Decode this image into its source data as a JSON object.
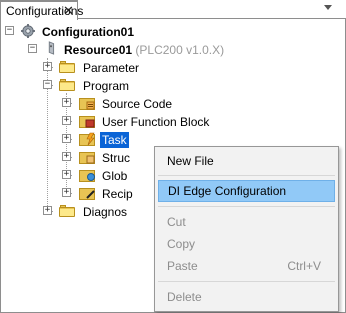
{
  "tab": {
    "label": "Configurations",
    "close": "✕"
  },
  "tree": {
    "configuration": "Configuration01",
    "resource": {
      "name": "Resource01",
      "meta": "(PLC200 v1.0.X)"
    },
    "parameter": "Parameter",
    "program": "Program",
    "source_code": "Source Code",
    "user_function_block": "User Function Block",
    "task": "Task",
    "struct": "Struc",
    "global": "Glob",
    "recipe": "Recip",
    "diagnostics": "Diagnos",
    "expand_minus": "−",
    "expand_plus": "+"
  },
  "context_menu": {
    "new_file": "New File",
    "di_edge": "DI Edge Configuration",
    "cut": "Cut",
    "copy": "Copy",
    "paste": "Paste",
    "paste_shortcut": "Ctrl+V",
    "delete": "Delete"
  },
  "colors": {
    "selection": "#0a64d6",
    "menu_highlight": "#91c9f7",
    "folder": "#e8c454"
  }
}
